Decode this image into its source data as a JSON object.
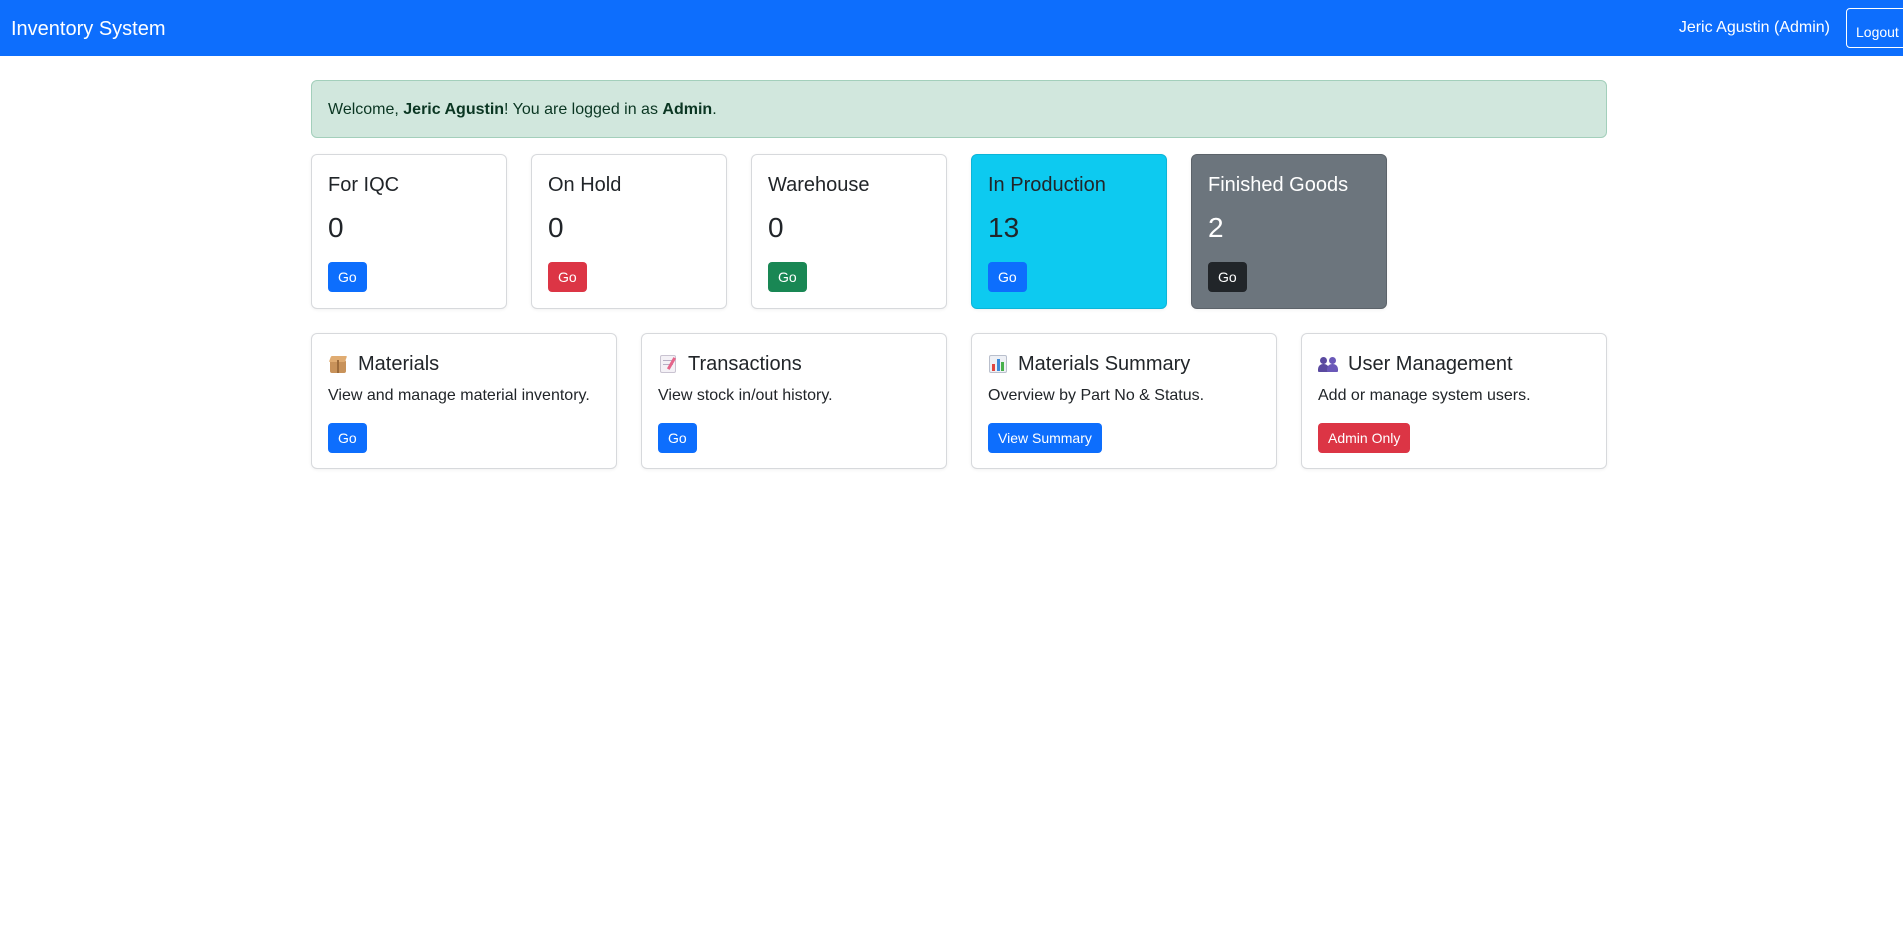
{
  "navbar": {
    "brand": "Inventory System",
    "user_label": "Jeric Agustin (Admin)",
    "logout_label": "Logout",
    "color": "#0d6efd"
  },
  "alert": {
    "prefix": "Welcome, ",
    "user_name": "Jeric Agustin",
    "middle": "! You are logged in as ",
    "role": "Admin",
    "suffix": "."
  },
  "stats": [
    {
      "title": "For IQC",
      "value": "0",
      "button": "Go",
      "button_color": "#0d6efd"
    },
    {
      "title": "On Hold",
      "value": "0",
      "button": "Go",
      "button_color": "#dc3545"
    },
    {
      "title": "Warehouse",
      "value": "0",
      "button": "Go",
      "button_color": "#198754"
    },
    {
      "title": "In Production",
      "value": "13",
      "button": "Go",
      "card_color": "#0dcaf0",
      "button_color": "#0d6efd"
    },
    {
      "title": "Finished Goods",
      "value": "2",
      "button": "Go",
      "card_color": "#6c757d",
      "button_color": "#212529"
    }
  ],
  "modules": [
    {
      "icon": "package-icon",
      "title": "Materials",
      "description": "View and manage material inventory.",
      "button": "Go",
      "button_color": "#0d6efd"
    },
    {
      "icon": "memo-icon",
      "title": "Transactions",
      "description": "View stock in/out history.",
      "button": "Go",
      "button_color": "#0d6efd"
    },
    {
      "icon": "bar-chart-icon",
      "title": "Materials Summary",
      "description": "Overview by Part No & Status.",
      "button": "View Summary",
      "button_color": "#0d6efd"
    },
    {
      "icon": "users-icon",
      "title": "User Management",
      "description": "Add or manage system users.",
      "button": "Admin Only",
      "button_color": "#dc3545"
    }
  ]
}
